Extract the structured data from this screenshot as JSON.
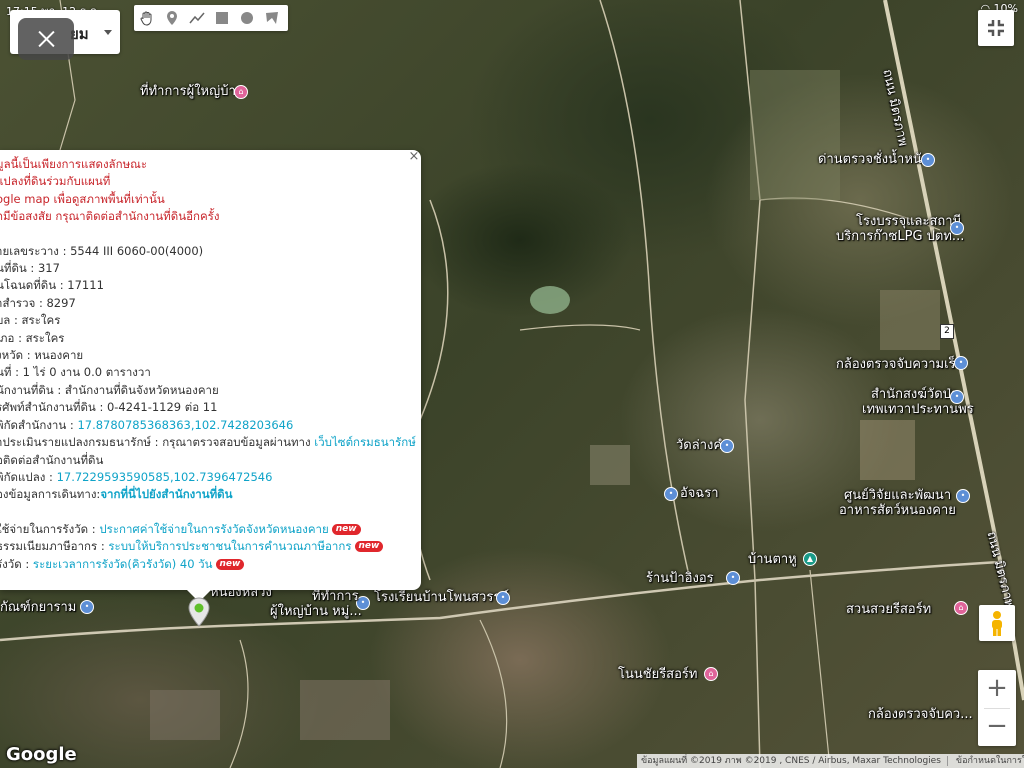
{
  "status_bar": {
    "time": "17:15",
    "date_fragment": "พฤ. 12 ธ.ค.",
    "battery": "10%"
  },
  "layer_select": {
    "label": "ยม"
  },
  "toolbar": {
    "tools": [
      "hand-icon",
      "pin-icon",
      "polyline-icon",
      "rectangle-icon",
      "circle-icon",
      "polygon-icon"
    ]
  },
  "info_window": {
    "notice_lines": [
      "มูลนี้เป็นเพียงการแสดงลักษณะ",
      "แปลงที่ดินร่วมกับแผนที่",
      "ogle map เพื่อดูสภาพพื้นที่เท่านั้น",
      "กมีข้อสงสัย กรุณาติดต่อสำนักงานที่ดินอีกครั้ง"
    ],
    "fields": [
      "ายเลขระวาง : 5544 III 6060-00(4000)",
      "นที่ดิน : 317",
      "นโฉนดที่ดิน : 17111",
      "าสำรวจ : 8297",
      "บล : สระใคร",
      "เภอ : สระใคร",
      "งหวัด : หนองคาย",
      "นที่ : 1 ไร่ 0 งาน 0.0 ตารางวา",
      "นักงานที่ดิน : สำนักงานที่ดินจังหวัดหนองคาย",
      "รศัพท์สำนักงานที่ดิน : 0-4241-1129 ต่อ 11"
    ],
    "office_coord_label": "พิกัดสำนักงาน : ",
    "office_coord_value": "17.8780785368363,102.7428203646",
    "appraisal_label": "าประเมินรายแปลงกรมธนารักษ์ : กรุณาตรวจสอบข้อมูลผ่านทาง ",
    "appraisal_link": "เว็บไซต์กรมธนารักษ์",
    "appraisal_cont": "อติดต่อสำนักงานที่ดิน",
    "parcel_coord_label": "พิกัดแปลง : ",
    "parcel_coord_value": "17.7229593590585,102.7396472546",
    "directions_label": "องข้อมูลการเดินทาง:",
    "directions_link": "จากที่นี่ไปยังสำนักงานที่ดิน",
    "fee_label": "ใช้จ่ายในการรังวัด : ",
    "fee_link": "ประกาศค่าใช้จ่ายในการรังวัดจังหวัดหนองคาย",
    "tax_label": "ธรรมเนียมภาษีอากร : ",
    "tax_link": "ระบบให้บริการประชาชนในการคำนวณภาษีอากร",
    "duration_label": "รังวัด : ",
    "duration_link": "ระยะเวลาการรังวัด(คิวรังวัด) 40 วัน",
    "new_badge": "new"
  },
  "map_labels": {
    "village_head_office": "ที่ทำการผู้ใหญ่บ้าน",
    "weigh_station": "ด่านตรวจชั่งน้ำหนัก",
    "lpg_station_1": "โรงบรรจุและสถานี",
    "lpg_station_2": "บริการก๊าซLPG ปตท...",
    "speed_camera_1": "กล้องตรวจจับความเร็ว",
    "priest_office_1": "สำนักสงฆ์วัดป่า",
    "priest_office_2": "เทพเทวาประทานพร",
    "wat_lang_kham": "วัดล่างคำ",
    "ajchara": "อัจฉรา",
    "research_center_1": "ศูนย์วิจัยและพัฒนา",
    "research_center_2": "อาหารสัตว์หนองคาย",
    "ban_tahu": "บ้านตาหู",
    "ban_pa_ing_on": "ร้านป้าอิงอร",
    "school": "โรงเรียนบ้านโพนสวรรค์",
    "village_head_2_line1": "ที่ทำการ",
    "village_head_2_line2": "ผู้ใหญ่บ้าน หมู่...",
    "nong_luang": "หนองหลวง",
    "kanyuk": "กัณฑ์กยาราม",
    "suan_suay_resort": "สวนสวยรีสอร์ท",
    "nonsuchai_resort": "โนนชัยรีสอร์ท",
    "speed_camera_2": "กล้องตรวจจับคว...",
    "highway_top": "ถนน มิตรภาพ",
    "highway_bottom": "ถนน มิตรภาพ",
    "highway_number": "2"
  },
  "google_logo": "Google",
  "attribution": {
    "data": "ข้อมูลแผนที่ ©2019 ภาพ ©2019 , CNES / Airbus, Maxar Technologies",
    "terms": "ข้อกำหนดในการใช้งาน"
  },
  "zoom": {
    "in": "+",
    "out": "−"
  }
}
